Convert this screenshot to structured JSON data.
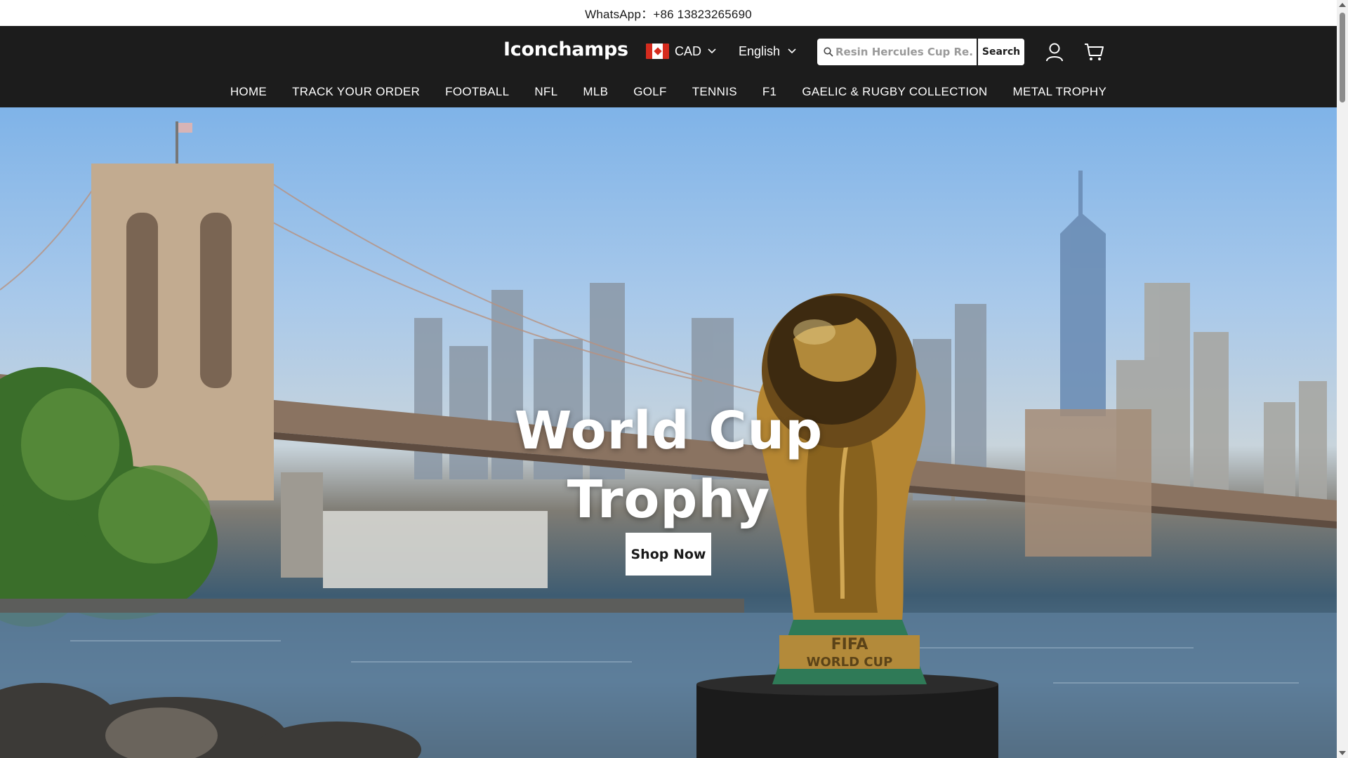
{
  "announcement": {
    "text": "WhatsApp：+86 13823265690"
  },
  "header": {
    "logo": "Iconchamps",
    "currency": {
      "code": "CAD",
      "flag_icon": "canada-flag-icon"
    },
    "language": "English",
    "search": {
      "placeholder": "Resin Hercules Cup Re...",
      "button_label": "Search"
    },
    "icons": [
      "account-icon",
      "cart-icon"
    ]
  },
  "nav": {
    "items": [
      {
        "label": "HOME"
      },
      {
        "label": "TRACK YOUR ORDER"
      },
      {
        "label": "FOOTBALL"
      },
      {
        "label": "NFL"
      },
      {
        "label": "MLB"
      },
      {
        "label": "GOLF"
      },
      {
        "label": "TENNIS"
      },
      {
        "label": "F1"
      },
      {
        "label": "GAELIC & RUGBY COLLECTION"
      },
      {
        "label": "METAL TROPHY"
      }
    ]
  },
  "hero": {
    "title_line1": "World Cup",
    "title_line2": "Trophy",
    "cta_label": "Shop Now",
    "trophy_base_text_1": "FIFA",
    "trophy_base_text_2": "WORLD CUP"
  },
  "colors": {
    "header_bg": "#1c1c1c",
    "announcement_bg": "#ffffff",
    "cta_bg": "#ffffff"
  }
}
